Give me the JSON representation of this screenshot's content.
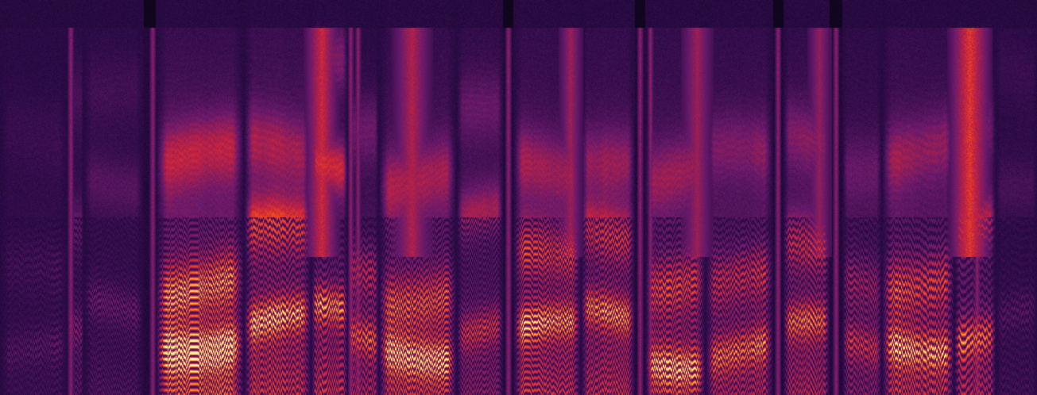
{
  "spectrogram": {
    "colormap": "inferno",
    "colors": {
      "background": "#06030f",
      "low": "#2a0b45",
      "mid_low": "#6b1a6b",
      "mid": "#c8233f",
      "mid_high": "#f2511a",
      "high": "#fca635",
      "peak": "#fcf4a3"
    },
    "frequency_axis": "linear-low-at-bottom",
    "segments": [
      {
        "start": 0.0,
        "end": 0.065,
        "level": 0.16,
        "tilt": 0.45,
        "formants": [
          0.1,
          0.3,
          0.65
        ]
      },
      {
        "start": 0.065,
        "end": 0.08,
        "level": 0.28,
        "tilt": 0.4,
        "formants": [
          0.14,
          0.42,
          0.78
        ]
      },
      {
        "start": 0.08,
        "end": 0.138,
        "level": 0.22,
        "tilt": 0.45,
        "formants": [
          0.22,
          0.55,
          0.8
        ]
      },
      {
        "start": 0.15,
        "end": 0.235,
        "level": 0.9,
        "tilt": 0.4,
        "formants": [
          0.14,
          0.28,
          0.6
        ]
      },
      {
        "start": 0.235,
        "end": 0.3,
        "level": 0.78,
        "tilt": 0.45,
        "formants": [
          0.18,
          0.4,
          0.62
        ]
      },
      {
        "start": 0.3,
        "end": 0.335,
        "level": 0.8,
        "tilt": 0.35,
        "formants": [
          0.2,
          0.58,
          0.88
        ]
      },
      {
        "start": 0.335,
        "end": 0.365,
        "level": 0.65,
        "tilt": 0.3,
        "formants": [
          0.14,
          0.33,
          0.7
        ]
      },
      {
        "start": 0.365,
        "end": 0.44,
        "level": 0.92,
        "tilt": 0.4,
        "formants": [
          0.12,
          0.26,
          0.55
        ]
      },
      {
        "start": 0.44,
        "end": 0.485,
        "level": 0.55,
        "tilt": 0.45,
        "formants": [
          0.18,
          0.45,
          0.7
        ]
      },
      {
        "start": 0.495,
        "end": 0.56,
        "level": 0.88,
        "tilt": 0.4,
        "formants": [
          0.16,
          0.34,
          0.58
        ]
      },
      {
        "start": 0.56,
        "end": 0.612,
        "level": 0.86,
        "tilt": 0.4,
        "formants": [
          0.2,
          0.42,
          0.62
        ]
      },
      {
        "start": 0.622,
        "end": 0.68,
        "level": 0.8,
        "tilt": 0.4,
        "formants": [
          0.1,
          0.3,
          0.56
        ]
      },
      {
        "start": 0.68,
        "end": 0.745,
        "level": 0.74,
        "tilt": 0.42,
        "formants": [
          0.12,
          0.28,
          0.6
        ]
      },
      {
        "start": 0.755,
        "end": 0.8,
        "level": 0.66,
        "tilt": 0.4,
        "formants": [
          0.16,
          0.36,
          0.66
        ]
      },
      {
        "start": 0.812,
        "end": 0.85,
        "level": 0.5,
        "tilt": 0.4,
        "formants": [
          0.12,
          0.3,
          0.6
        ]
      },
      {
        "start": 0.85,
        "end": 0.92,
        "level": 0.86,
        "tilt": 0.4,
        "formants": [
          0.14,
          0.3,
          0.62
        ]
      },
      {
        "start": 0.92,
        "end": 0.96,
        "level": 0.72,
        "tilt": 0.35,
        "formants": [
          0.16,
          0.42,
          0.65
        ]
      },
      {
        "start": 0.96,
        "end": 1.0,
        "level": 0.2,
        "tilt": 0.45,
        "formants": [
          0.2,
          0.5,
          0.8
        ]
      }
    ],
    "stripes": [
      0.068,
      0.147,
      0.338,
      0.345,
      0.49,
      0.617,
      0.627,
      0.75,
      0.806,
      0.942
    ],
    "high_band_bursts": [
      {
        "center": 0.31,
        "width": 0.018,
        "strength": 0.8
      },
      {
        "center": 0.397,
        "width": 0.02,
        "strength": 0.65
      },
      {
        "center": 0.55,
        "width": 0.012,
        "strength": 0.55
      },
      {
        "center": 0.672,
        "width": 0.016,
        "strength": 0.55
      },
      {
        "center": 0.79,
        "width": 0.012,
        "strength": 0.5
      },
      {
        "center": 0.935,
        "width": 0.022,
        "strength": 0.95
      }
    ]
  }
}
